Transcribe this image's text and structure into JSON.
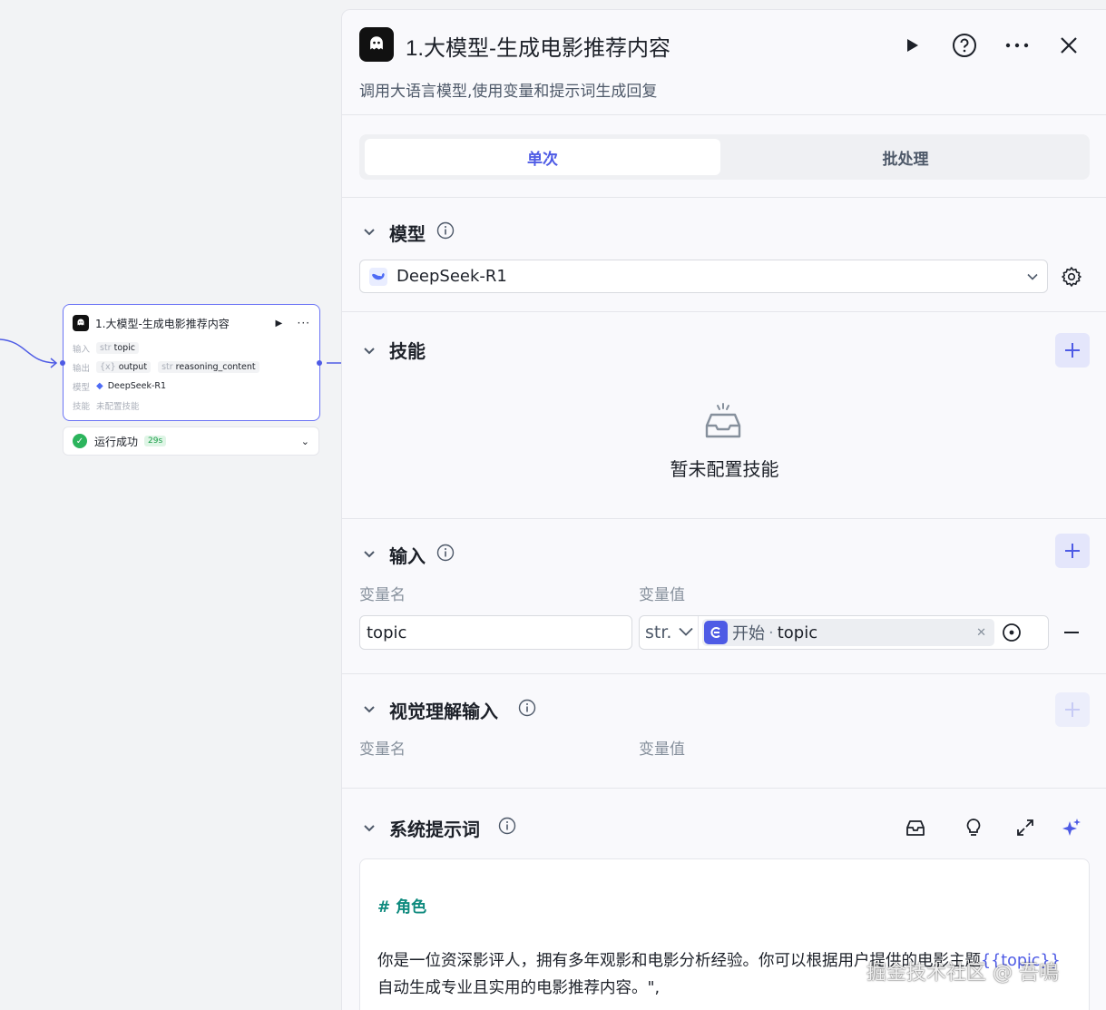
{
  "canvas": {
    "node": {
      "title": "1.大模型-生成电影推荐内容",
      "rows": [
        {
          "label": "输入",
          "items": [
            {
              "type": "str",
              "name": "topic"
            }
          ]
        },
        {
          "label": "输出",
          "items": [
            {
              "type": "{x}",
              "name": "output"
            },
            {
              "type": "str",
              "name": "reasoning_content"
            }
          ]
        },
        {
          "label": "模型",
          "value": "DeepSeek-R1"
        },
        {
          "label": "技能",
          "value": "未配置技能"
        }
      ]
    },
    "status": {
      "text": "运行成功",
      "time": "29s"
    }
  },
  "panel": {
    "title": "1.大模型-生成电影推荐内容",
    "description": "调用大语言模型,使用变量和提示词生成回复",
    "tabs": [
      {
        "label": "单次",
        "active": true
      },
      {
        "label": "批处理",
        "active": false
      }
    ],
    "model_section": {
      "title": "模型",
      "selected_model": "DeepSeek-R1"
    },
    "skills_section": {
      "title": "技能",
      "empty_text": "暂未配置技能"
    },
    "input_section": {
      "title": "输入",
      "col_name": "变量名",
      "col_value": "变量值",
      "rows": [
        {
          "name": "topic",
          "type": "str.",
          "ref_node": "开始",
          "ref_sep": "·",
          "ref_var": "topic"
        }
      ]
    },
    "vision_section": {
      "title": "视觉理解输入",
      "col_name": "变量名",
      "col_value": "变量值"
    },
    "prompt_section": {
      "title": "系统提示词",
      "heading": "# 角色",
      "text_before": "你是一位资深影评人，拥有多年观影和电影分析经验。你可以根据用户提供的电影主题",
      "variable": "{{topic}}",
      "text_after": "自动生成专业且实用的电影推荐内容。\","
    }
  },
  "watermark": "掘金技术社区 @ 吾鳴",
  "colors": {
    "accent": "#4e5be5",
    "success": "#2bb45c",
    "heading": "#0e8a7e"
  }
}
